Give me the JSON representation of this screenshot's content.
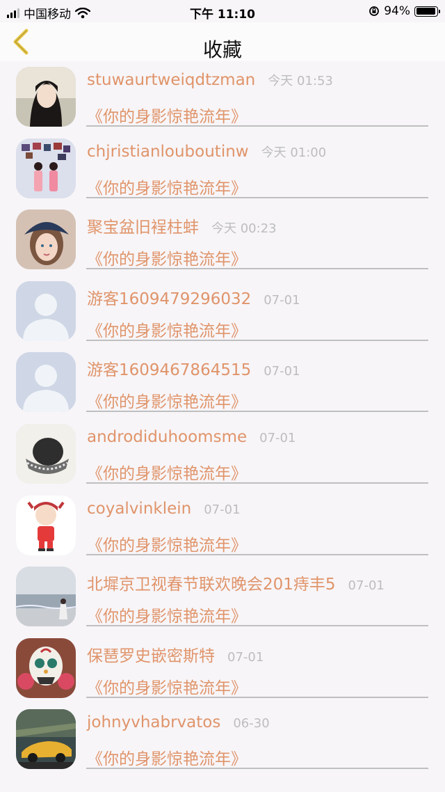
{
  "status_bar": {
    "carrier": "中国移动",
    "time": "下午 11:10",
    "battery": "94%"
  },
  "nav": {
    "title": "收藏",
    "back_icon": "chevron-left-icon"
  },
  "colors": {
    "accent": "#e0946a",
    "back": "#e8c94a",
    "date": "#bdbdbd",
    "divider": "#bfbfbf"
  },
  "items": [
    {
      "name": "stuwaurtweiqdtzman",
      "date": "今天 01:53",
      "book": "《你的身影惊艳流年》",
      "avatar": "girl-portrait"
    },
    {
      "name": "chjristianlouboutinw",
      "date": "今天 01:00",
      "book": "《你的身影惊艳流年》",
      "avatar": "couple-photo"
    },
    {
      "name": "聚宝盆旧裎柱蚌",
      "date": "今天 00:23",
      "book": "《你的身影惊艳流年》",
      "avatar": "girl-hat"
    },
    {
      "name": "游客1609479296032",
      "date": "07-01",
      "book": "《你的身影惊艳流年》",
      "avatar": "default-user"
    },
    {
      "name": "游客1609467864515",
      "date": "07-01",
      "book": "《你的身影惊艳流年》",
      "avatar": "default-user"
    },
    {
      "name": "androdiduhoomsme",
      "date": "07-01",
      "book": "《你的身影惊艳流年》",
      "avatar": "hat-object"
    },
    {
      "name": "coyalvinklein",
      "date": "07-01",
      "book": "《你的身影惊艳流年》",
      "avatar": "cartoon"
    },
    {
      "name": "北墀京卫视春节联欢晚会201痔丰5",
      "date": "07-01",
      "book": "《你的身影惊艳流年》",
      "avatar": "seaside"
    },
    {
      "name": "保琶罗史嵌密斯特",
      "date": "07-01",
      "book": "《你的身影惊艳流年》",
      "avatar": "sugar-skull"
    },
    {
      "name": "johnyvhabrvatos",
      "date": "06-30",
      "book": "《你的身影惊艳流年》",
      "avatar": "sports-car"
    }
  ]
}
